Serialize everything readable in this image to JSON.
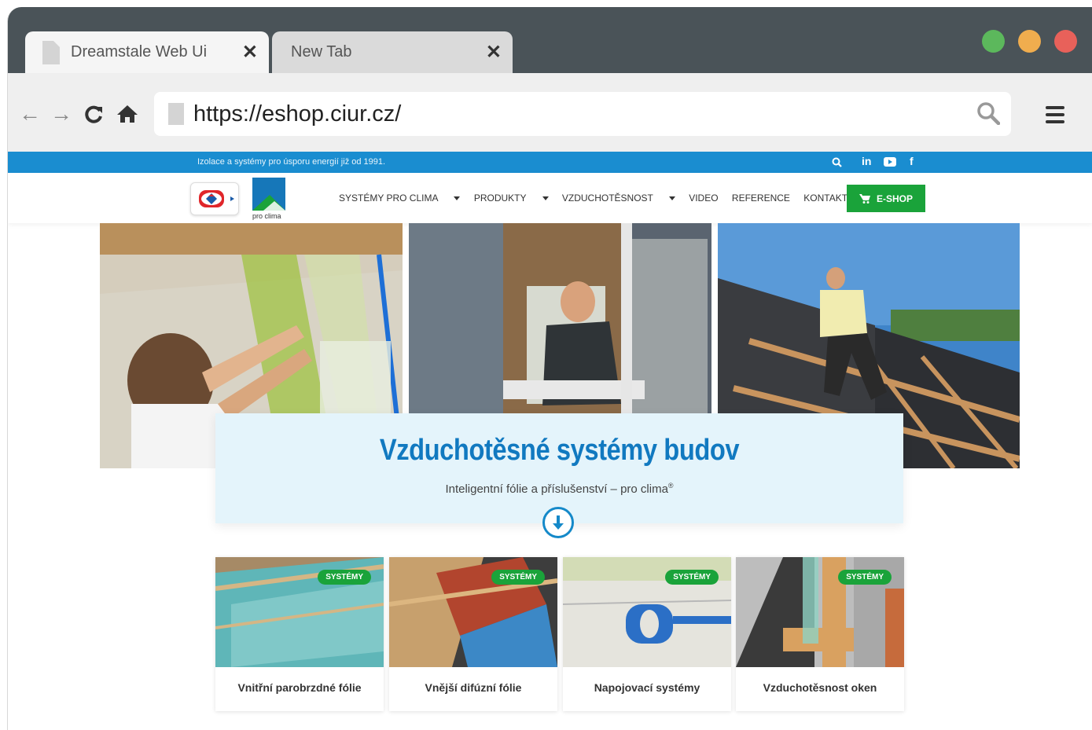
{
  "browser": {
    "tabs": [
      {
        "label": "Dreamstale Web Ui",
        "close": "✕"
      },
      {
        "label": "New Tab",
        "close": "✕"
      }
    ],
    "window_controls": {
      "green": "#5cb85c",
      "yellow": "#f0ad4e",
      "red": "#e8615a"
    },
    "address": {
      "url": "https://eshop.ciur.cz/"
    },
    "nav_icons": [
      "back-arrow-icon",
      "forward-arrow-icon",
      "reload-icon",
      "home-icon",
      "search-icon",
      "hamburger-menu-icon"
    ]
  },
  "site": {
    "topbar": {
      "tagline": "Izolace a systémy pro úsporu energií již od 1991.",
      "icons": [
        "search-icon",
        "linkedin-icon",
        "youtube-icon",
        "facebook-icon"
      ],
      "linkedin_label": "in",
      "facebook_label": "f"
    },
    "logos": {
      "procl_text": "pro clima"
    },
    "menu": [
      {
        "label": "SYSTÉMY PRO CLIMA",
        "dropdown": true
      },
      {
        "label": "PRODUKTY",
        "dropdown": true
      },
      {
        "label": "VZDUCHOTĚSNOST",
        "dropdown": true
      },
      {
        "label": "VIDEO",
        "dropdown": false
      },
      {
        "label": "REFERENCE",
        "dropdown": false
      },
      {
        "label": "KONTAKT",
        "dropdown": false
      }
    ],
    "eshop_label": "E-SHOP",
    "hero": {
      "title": "Vzduchotěsné systémy budov",
      "subtitle": "Inteligentní fólie a příslušenství – pro clima",
      "subtitle_mark": "®"
    },
    "tiles": [
      {
        "badge": "SYSTÉMY",
        "title": "Vnitřní parobrzdné fólie"
      },
      {
        "badge": "SYSTÉMY",
        "title": "Vnější difúzní fólie"
      },
      {
        "badge": "SYSTÉMY",
        "title": "Napojovací systémy"
      },
      {
        "badge": "SYSTÉMY",
        "title": "Vzduchotěsnost oken"
      }
    ],
    "colors": {
      "accent_blue": "#1a8dd0",
      "title_blue": "#1179c0",
      "green": "#1aa33a"
    }
  }
}
